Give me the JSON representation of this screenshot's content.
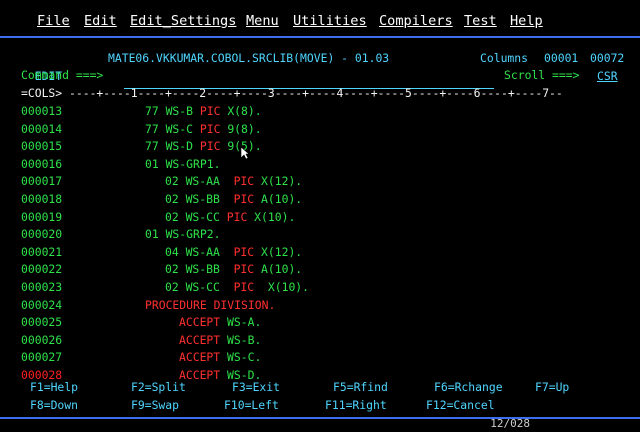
{
  "menu": [
    {
      "label": "File"
    },
    {
      "label": "Edit"
    },
    {
      "label": "Edit_Settings"
    },
    {
      "label": "Menu"
    },
    {
      "label": "Utilities"
    },
    {
      "label": "Compilers"
    },
    {
      "label": "Test"
    },
    {
      "label": "Help"
    }
  ],
  "header": {
    "mode": "EDIT",
    "dataset": "MATE06.VKKUMAR.COBOL.SRCLIB(MOVE) - 01.03",
    "columns_label": "Columns",
    "columns_from": "00001",
    "columns_to": "00072",
    "command_label": "Command ===>",
    "command_value": "",
    "scroll_label": "Scroll ===>",
    "scroll_value": "CSR"
  },
  "cols_ruler": "=COLS> ----+----1----+----2----+----3----+----4----+----5----+----6----+----7--",
  "lines": [
    {
      "num": "000013",
      "parts": [
        {
          "t": "77 WS-B ",
          "c": "green"
        },
        {
          "t": "PIC ",
          "c": "red"
        },
        {
          "t": "X(8).",
          "c": "green"
        }
      ],
      "indent": 18
    },
    {
      "num": "000014",
      "parts": [
        {
          "t": "77 WS-C ",
          "c": "green"
        },
        {
          "t": "PIC ",
          "c": "red"
        },
        {
          "t": "9(8).",
          "c": "green"
        }
      ],
      "indent": 18
    },
    {
      "num": "000015",
      "parts": [
        {
          "t": "77 WS-D ",
          "c": "green"
        },
        {
          "t": "PIC ",
          "c": "red"
        },
        {
          "t": "9(5).",
          "c": "green"
        }
      ],
      "indent": 18
    },
    {
      "num": "000016",
      "parts": [
        {
          "t": "01 WS-GRP1.",
          "c": "green"
        }
      ],
      "indent": 18
    },
    {
      "num": "000017",
      "parts": [
        {
          "t": "02 WS-AA  ",
          "c": "green"
        },
        {
          "t": "PIC ",
          "c": "red"
        },
        {
          "t": "X(12).",
          "c": "green"
        }
      ],
      "indent": 21
    },
    {
      "num": "000018",
      "parts": [
        {
          "t": "02 WS-BB  ",
          "c": "green"
        },
        {
          "t": "PIC ",
          "c": "red"
        },
        {
          "t": "A(10).",
          "c": "green"
        }
      ],
      "indent": 21
    },
    {
      "num": "000019",
      "parts": [
        {
          "t": "02 WS-CC ",
          "c": "green"
        },
        {
          "t": "PIC ",
          "c": "red"
        },
        {
          "t": "X(10).",
          "c": "green"
        }
      ],
      "indent": 21
    },
    {
      "num": "000020",
      "parts": [
        {
          "t": "01 WS-GRP2.",
          "c": "green"
        }
      ],
      "indent": 18
    },
    {
      "num": "000021",
      "parts": [
        {
          "t": "04 WS-AA  ",
          "c": "green"
        },
        {
          "t": "PIC ",
          "c": "red"
        },
        {
          "t": "X(12).",
          "c": "green"
        }
      ],
      "indent": 21
    },
    {
      "num": "000022",
      "parts": [
        {
          "t": "02 WS-BB  ",
          "c": "green"
        },
        {
          "t": "PIC ",
          "c": "red"
        },
        {
          "t": "A(10).",
          "c": "green"
        }
      ],
      "indent": 21
    },
    {
      "num": "000023",
      "parts": [
        {
          "t": "02 WS-CC  ",
          "c": "green"
        },
        {
          "t": "PIC  ",
          "c": "red"
        },
        {
          "t": "X(10).",
          "c": "green"
        }
      ],
      "indent": 21
    },
    {
      "num": "000024",
      "parts": [
        {
          "t": "PROCEDURE DIVISION.",
          "c": "red"
        }
      ],
      "indent": 18
    },
    {
      "num": "000025",
      "parts": [
        {
          "t": "ACCEPT ",
          "c": "red"
        },
        {
          "t": "WS-A.",
          "c": "green"
        }
      ],
      "indent": 23
    },
    {
      "num": "000026",
      "parts": [
        {
          "t": "ACCEPT ",
          "c": "red"
        },
        {
          "t": "WS-B.",
          "c": "green"
        }
      ],
      "indent": 23
    },
    {
      "num": "000027",
      "parts": [
        {
          "t": "ACCEPT ",
          "c": "red"
        },
        {
          "t": "WS-C.",
          "c": "green"
        }
      ],
      "indent": 23
    },
    {
      "num": "000028",
      "parts": [
        {
          "t": "ACCEPT ",
          "c": "red"
        },
        {
          "t": "WS-D.",
          "c": "green"
        }
      ],
      "indent": 23,
      "num_red": true
    }
  ],
  "pfkeys_row1": [
    "F1=Help",
    "F2=Split",
    "F3=Exit",
    "F5=Rfind",
    "F6=Rchange",
    "F7=Up"
  ],
  "pfkeys_row2": [
    "F8=Down",
    "F9=Swap",
    "F10=Left",
    "F11=Right",
    "F12=Cancel"
  ],
  "status_hint": "12/028",
  "colors": {
    "background": "#000000",
    "field": "#4fd6ff",
    "text": "#2ee24a",
    "keyword": "#ff3030",
    "menu": "#ffffff",
    "rule": "#3c6ff0"
  }
}
